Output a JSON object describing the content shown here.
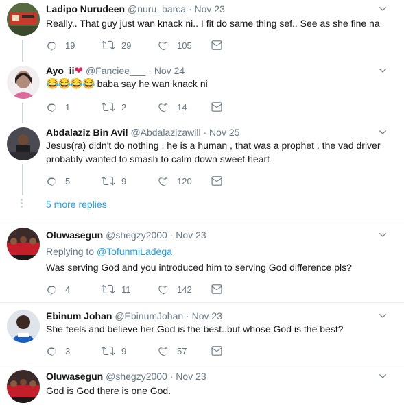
{
  "tweets": [
    {
      "name": "Ladipo Nurudeen",
      "handle": "@nuru_barca",
      "sep": "·",
      "time": "Nov 23",
      "text": "Really.. That guy just wan knack ni.. I fit do same thing sef.. See as she fine na",
      "replies": "19",
      "retweets": "29",
      "likes": "105"
    },
    {
      "name": "Ayo_ii",
      "handle": "@Fanciee___",
      "sep": "·",
      "time": "Nov 24",
      "text": "baba say he wan knack ni",
      "emoji": "😂😂😂😂",
      "replies": "1",
      "retweets": "2",
      "likes": "14"
    },
    {
      "name": "Abdalaziz Bin Avil",
      "handle": "@Abdalazizawill",
      "sep": "·",
      "time": "Nov 25",
      "text1": "Jesus(ra) didn't do nothing , he is a human , that was a prophet , the vad driver",
      "text2": "probably wanted to smash to calm down sweet heart",
      "replies": "5",
      "retweets": "9",
      "likes": "120"
    },
    {
      "name": "Oluwasegun",
      "handle": "@shegzy2000",
      "sep": "·",
      "time": "Nov 23",
      "replying_prefix": "Replying to",
      "replying_to": "@TofunmiLadega",
      "text": "Was serving God and you introduced him to serving God difference pls?",
      "replies": "4",
      "retweets": "11",
      "likes": "142"
    },
    {
      "name": "Ebinum Johan",
      "handle": "@EbinumJohan",
      "sep": "·",
      "time": "Nov 23",
      "text": "She feels and believe her God is the best..but whose God is the best?",
      "replies": "3",
      "retweets": "9",
      "likes": "57"
    },
    {
      "name": "Oluwasegun",
      "handle": "@shegzy2000",
      "sep": "·",
      "time": "Nov 23",
      "text": "God is God there is one God."
    }
  ],
  "more_replies": "5 more replies",
  "colors": {
    "accent": "#1da1f2",
    "muted": "#657786",
    "heart_emoji": "#e0245e",
    "line": "#ccd6dd"
  }
}
